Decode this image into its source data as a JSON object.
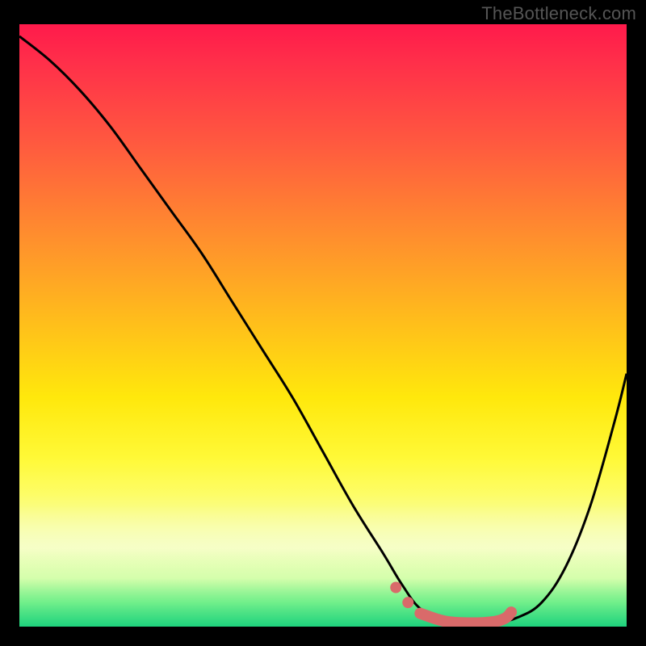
{
  "watermark": "TheBottleneck.com",
  "colors": {
    "background": "#000000",
    "curve": "#000000",
    "highlight": "#d96a6a",
    "watermark_text": "#555555"
  },
  "chart_data": {
    "type": "line",
    "title": "",
    "xlabel": "",
    "ylabel": "",
    "xlim": [
      0,
      100
    ],
    "ylim": [
      0,
      100
    ],
    "series": [
      {
        "name": "bottleneck-curve",
        "x": [
          0,
          5,
          10,
          15,
          20,
          25,
          30,
          35,
          40,
          45,
          50,
          55,
          60,
          63,
          66,
          70,
          74,
          78,
          82,
          86,
          90,
          94,
          98,
          100
        ],
        "y": [
          98,
          94,
          89,
          83,
          76,
          69,
          62,
          54,
          46,
          38,
          29,
          20,
          12,
          7,
          3,
          1,
          0.5,
          0.5,
          1.5,
          4,
          10,
          20,
          34,
          42
        ]
      },
      {
        "name": "optimal-highlight",
        "x": [
          62,
          64,
          66,
          70,
          74,
          78,
          80,
          81
        ],
        "y": [
          6.5,
          4,
          2.2,
          0.9,
          0.6,
          0.8,
          1.4,
          2.4
        ]
      }
    ]
  }
}
